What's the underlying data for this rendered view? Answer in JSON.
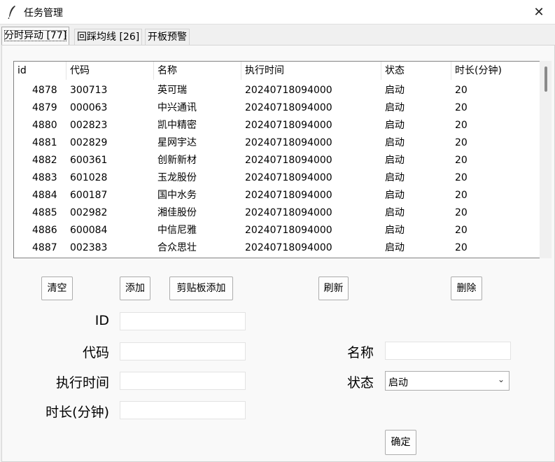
{
  "window": {
    "title": "任务管理",
    "close_glyph": "✕"
  },
  "tabs": [
    {
      "label": "分时异动 [77]",
      "active": true
    },
    {
      "label": "回踩均线 [26]",
      "active": false
    },
    {
      "label": "开板预警",
      "active": false
    }
  ],
  "table": {
    "columns": [
      "id",
      "代码",
      "名称",
      "执行时间",
      "状态",
      "时长(分钟)"
    ],
    "rows": [
      [
        "4878",
        "300713",
        "英可瑞",
        "20240718094000",
        "启动",
        "20"
      ],
      [
        "4879",
        "000063",
        "中兴通讯",
        "20240718094000",
        "启动",
        "20"
      ],
      [
        "4880",
        "002823",
        "凯中精密",
        "20240718094000",
        "启动",
        "20"
      ],
      [
        "4881",
        "002829",
        "星网宇达",
        "20240718094000",
        "启动",
        "20"
      ],
      [
        "4882",
        "600361",
        "创新新材",
        "20240718094000",
        "启动",
        "20"
      ],
      [
        "4883",
        "601028",
        "玉龙股份",
        "20240718094000",
        "启动",
        "20"
      ],
      [
        "4884",
        "600187",
        "国中水务",
        "20240718094000",
        "启动",
        "20"
      ],
      [
        "4885",
        "002982",
        "湘佳股份",
        "20240718094000",
        "启动",
        "20"
      ],
      [
        "4886",
        "600084",
        "中信尼雅",
        "20240718094000",
        "启动",
        "20"
      ],
      [
        "4887",
        "002383",
        "合众思壮",
        "20240718094000",
        "启动",
        "20"
      ]
    ]
  },
  "buttons": {
    "clear": "清空",
    "add": "添加",
    "clipboard_add": "剪贴板添加",
    "refresh": "刷新",
    "delete": "删除",
    "confirm": "确定"
  },
  "form": {
    "id_label": "ID",
    "id_value": "",
    "code_label": "代码",
    "code_value": "",
    "exec_time_label": "执行时间",
    "exec_time_value": "",
    "duration_label": "时长(分钟)",
    "duration_value": "",
    "name_label": "名称",
    "name_value": "",
    "status_label": "状态",
    "status_value": "启动"
  },
  "icons": {
    "app": "feather-icon",
    "dropdown": "chevron-down-icon"
  }
}
